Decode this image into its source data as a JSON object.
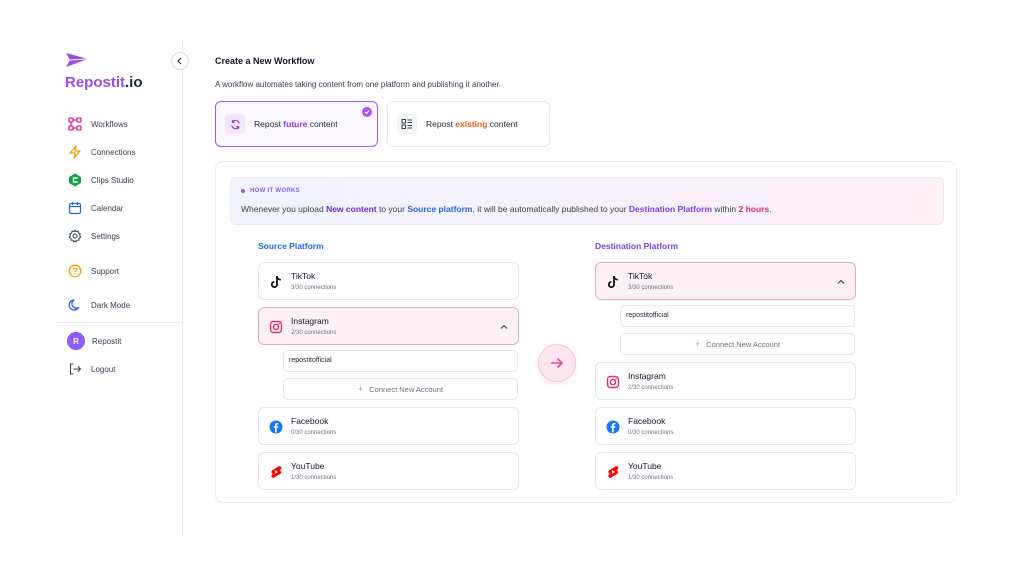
{
  "brand": {
    "name": "Repostit",
    "tld": ".io",
    "accent": "#9b4de8"
  },
  "sidebar": {
    "items": [
      {
        "label": "Workflows",
        "icon": "workflow-icon"
      },
      {
        "label": "Connections",
        "icon": "bolt-icon"
      },
      {
        "label": "Clips Studio",
        "icon": "clips-studio-icon"
      },
      {
        "label": "Calendar",
        "icon": "calendar-icon"
      },
      {
        "label": "Settings",
        "icon": "gear-icon"
      },
      {
        "label": "Support",
        "icon": "help-circle-icon"
      },
      {
        "label": "Dark Mode",
        "icon": "moon-icon"
      }
    ],
    "user": {
      "initial": "R",
      "name": "Repostit"
    },
    "logout_label": "Logout"
  },
  "main": {
    "title": "Create a New Workflow",
    "description": "A workflow automates taking content from one platform and publishing it another.",
    "options": {
      "future": {
        "prefix": "Repost ",
        "highlight": "future",
        "suffix": " content",
        "selected": true
      },
      "existing": {
        "prefix": "Repost ",
        "highlight": "existing",
        "suffix": " content",
        "selected": false
      }
    },
    "how_it_works": {
      "tag": "HOW IT WORKS",
      "t1": "Whenever you upload ",
      "h1": "New content",
      "t2": " to your ",
      "h2": "Source platform",
      "t3": ", it will be automatically published to your ",
      "h3": "Destination Platform",
      "t4": " within ",
      "h4": "2 hours",
      "t5": "."
    },
    "source": {
      "title": "Source Platform",
      "platforms": [
        {
          "name": "TikTok",
          "count": "3/30 connections",
          "icon": "tiktok-icon"
        },
        {
          "name": "Instagram",
          "count": "2/30 connections",
          "icon": "instagram-icon",
          "expanded": true
        },
        {
          "name": "Facebook",
          "count": "0/30 connections",
          "icon": "facebook-icon"
        },
        {
          "name": "YouTube",
          "count": "1/30 connections",
          "icon": "youtube-shorts-icon"
        }
      ],
      "account": "repostitofficial",
      "connect_label": "Connect New Account"
    },
    "destination": {
      "title": "Destination Platform",
      "platforms": [
        {
          "name": "TikTok",
          "count": "3/30 connections",
          "icon": "tiktok-icon",
          "expanded": true
        },
        {
          "name": "Instagram",
          "count": "2/30 connections",
          "icon": "instagram-icon"
        },
        {
          "name": "Facebook",
          "count": "0/30 connections",
          "icon": "facebook-icon"
        },
        {
          "name": "YouTube",
          "count": "1/30 connections",
          "icon": "youtube-shorts-icon"
        }
      ],
      "account": "repostitofficial",
      "connect_label": "Connect New Account"
    }
  },
  "colors": {
    "purple": "#a855f7",
    "orange": "#ea580c",
    "blue": "#2563eb",
    "pink": "#db2777"
  }
}
